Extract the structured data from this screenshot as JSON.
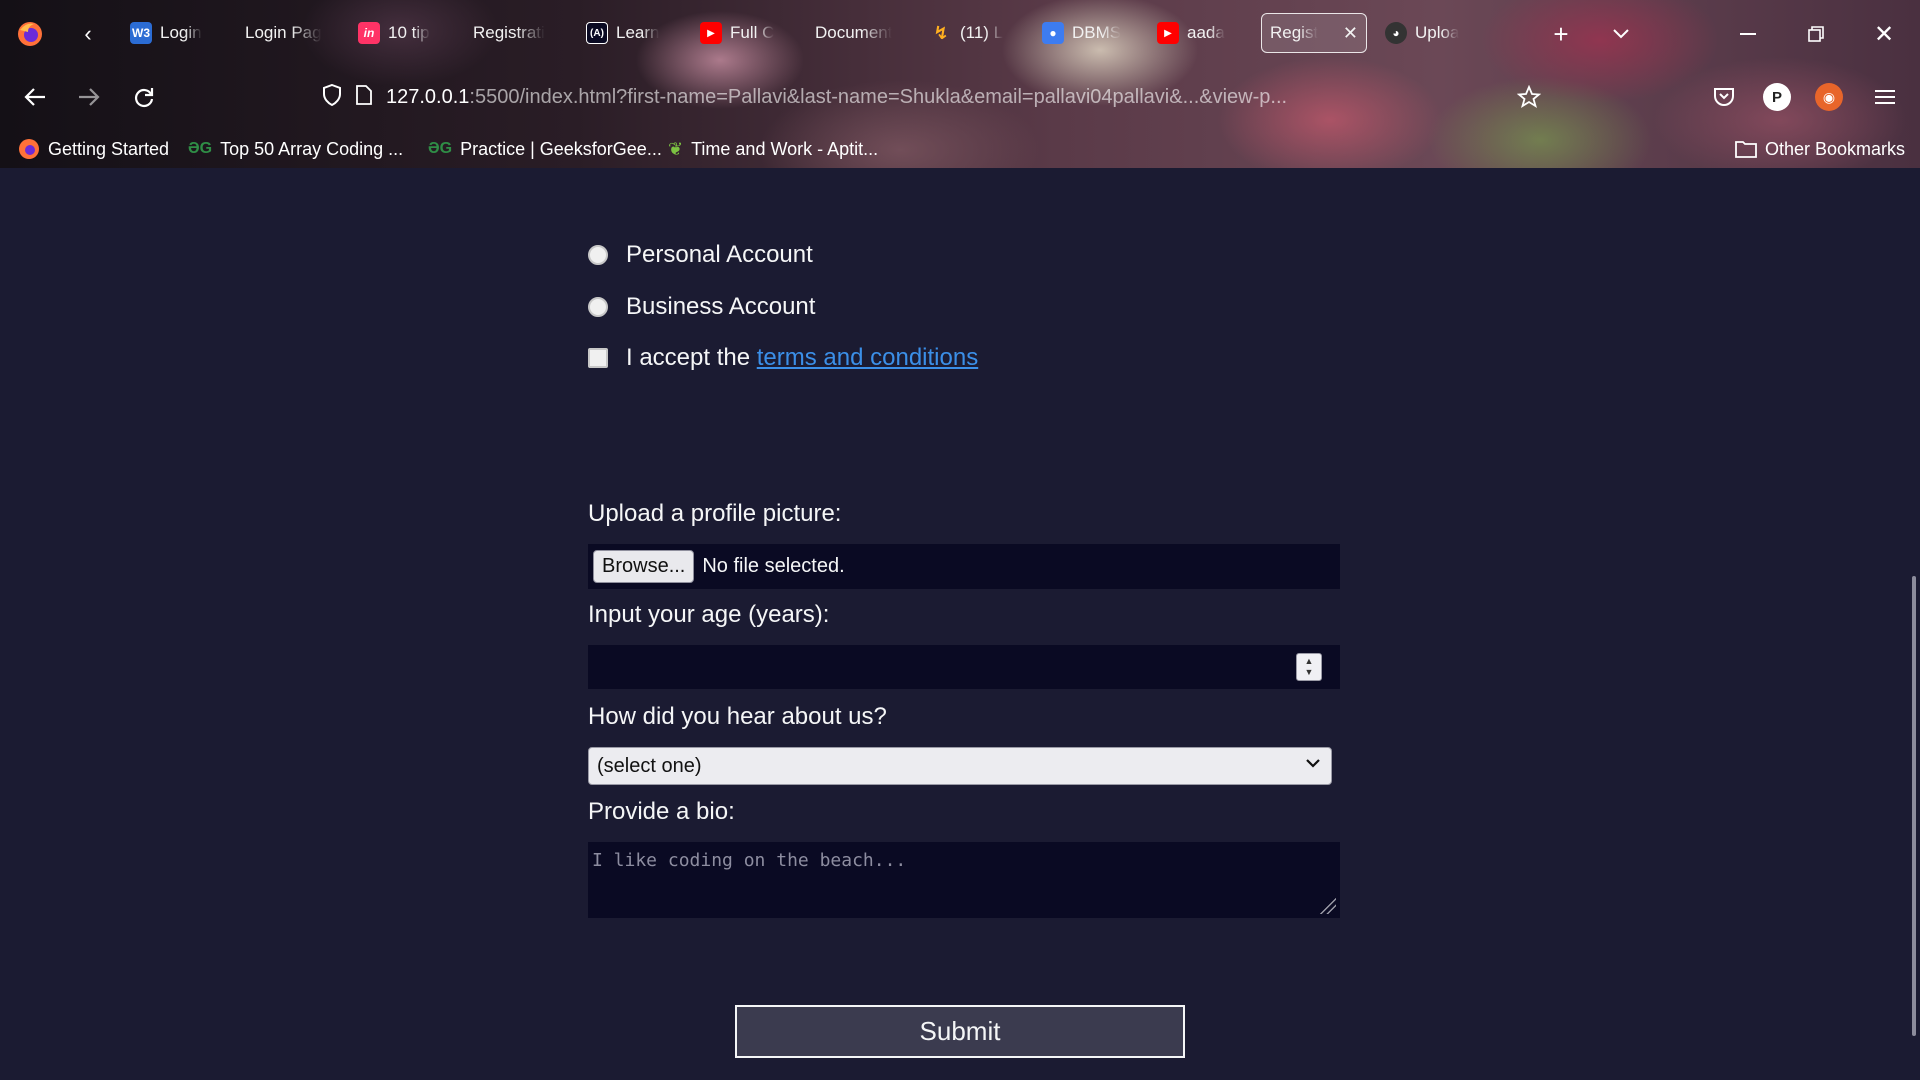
{
  "browser": {
    "tabs": [
      {
        "label": "Login",
        "icon": "w3schools-icon"
      },
      {
        "label": "Login Pag",
        "icon": "none"
      },
      {
        "label": "10 tip",
        "icon": "invision-icon"
      },
      {
        "label": "Registrati",
        "icon": "none"
      },
      {
        "label": "Learn",
        "icon": "freecodecamp-icon"
      },
      {
        "label": "Full C",
        "icon": "youtube-icon"
      },
      {
        "label": "Document",
        "icon": "none"
      },
      {
        "label": "(11) L",
        "icon": "site-icon"
      },
      {
        "label": "DBMS",
        "icon": "contacts-icon"
      },
      {
        "label": "aada",
        "icon": "youtube-icon"
      },
      {
        "label": "Regist",
        "icon": "none",
        "active": true
      },
      {
        "label": "Uploa",
        "icon": "github-icon"
      }
    ],
    "url_host": "127.0.0.1",
    "url_rest": ":5500/index.html?first-name=Pallavi&last-name=Shukla&email=pallavi04pallavi&...&view-p...",
    "avatar_letter": "P",
    "bookmarks": [
      {
        "label": "Getting Started"
      },
      {
        "label": "Top 50 Array Coding ..."
      },
      {
        "label": "Practice | GeeksforGee..."
      },
      {
        "label": "Time and Work - Aptit..."
      }
    ],
    "other_bookmarks": "Other Bookmarks",
    "tab_icon_text": {
      "w3": "W3",
      "inv": "in",
      "fcc": "(A)"
    }
  },
  "form": {
    "account_type": [
      {
        "label": "Personal Account"
      },
      {
        "label": "Business Account"
      }
    ],
    "terms_prefix": "I accept the ",
    "terms_link": "terms and conditions",
    "upload_label": "Upload a profile picture:",
    "browse_button": "Browse...",
    "file_status": "No file selected.",
    "age_label": "Input your age (years):",
    "age_value": "",
    "referrer_label": "How did you hear about us?",
    "referrer_selected": "(select one)",
    "bio_label": "Provide a bio:",
    "bio_placeholder": "I like coding on the beach...",
    "submit_label": "Submit"
  },
  "colors": {
    "page_background": "#1b1b32",
    "field_background": "#0a0a23",
    "link": "#3b8fe8",
    "submit_background": "#3b3b4f"
  }
}
